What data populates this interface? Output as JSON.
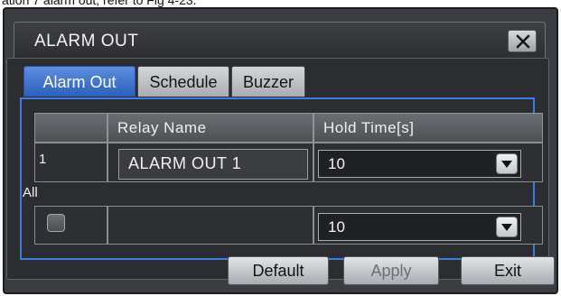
{
  "caption": "ation 7 alarm out, refer to Fig 4-23.",
  "dialog": {
    "title": "ALARM OUT",
    "close_icon": "close-x-icon"
  },
  "tabs": [
    {
      "label": "Alarm Out",
      "active": true
    },
    {
      "label": "Schedule",
      "active": false
    },
    {
      "label": "Buzzer",
      "active": false
    }
  ],
  "table": {
    "headers": [
      "",
      "Relay Name",
      "Hold Time[s]"
    ],
    "rows": [
      {
        "num": "1",
        "relay_name": "ALARM OUT 1",
        "hold_time": "10"
      }
    ]
  },
  "all": {
    "label": "All",
    "checked": false,
    "hold_time": "10"
  },
  "buttons": {
    "default": "Default",
    "apply": "Apply",
    "exit": "Exit"
  },
  "colors": {
    "active_tab": "#3a6fd0",
    "panel_border": "#3e7de0",
    "window_bg": "#3a3d41"
  }
}
